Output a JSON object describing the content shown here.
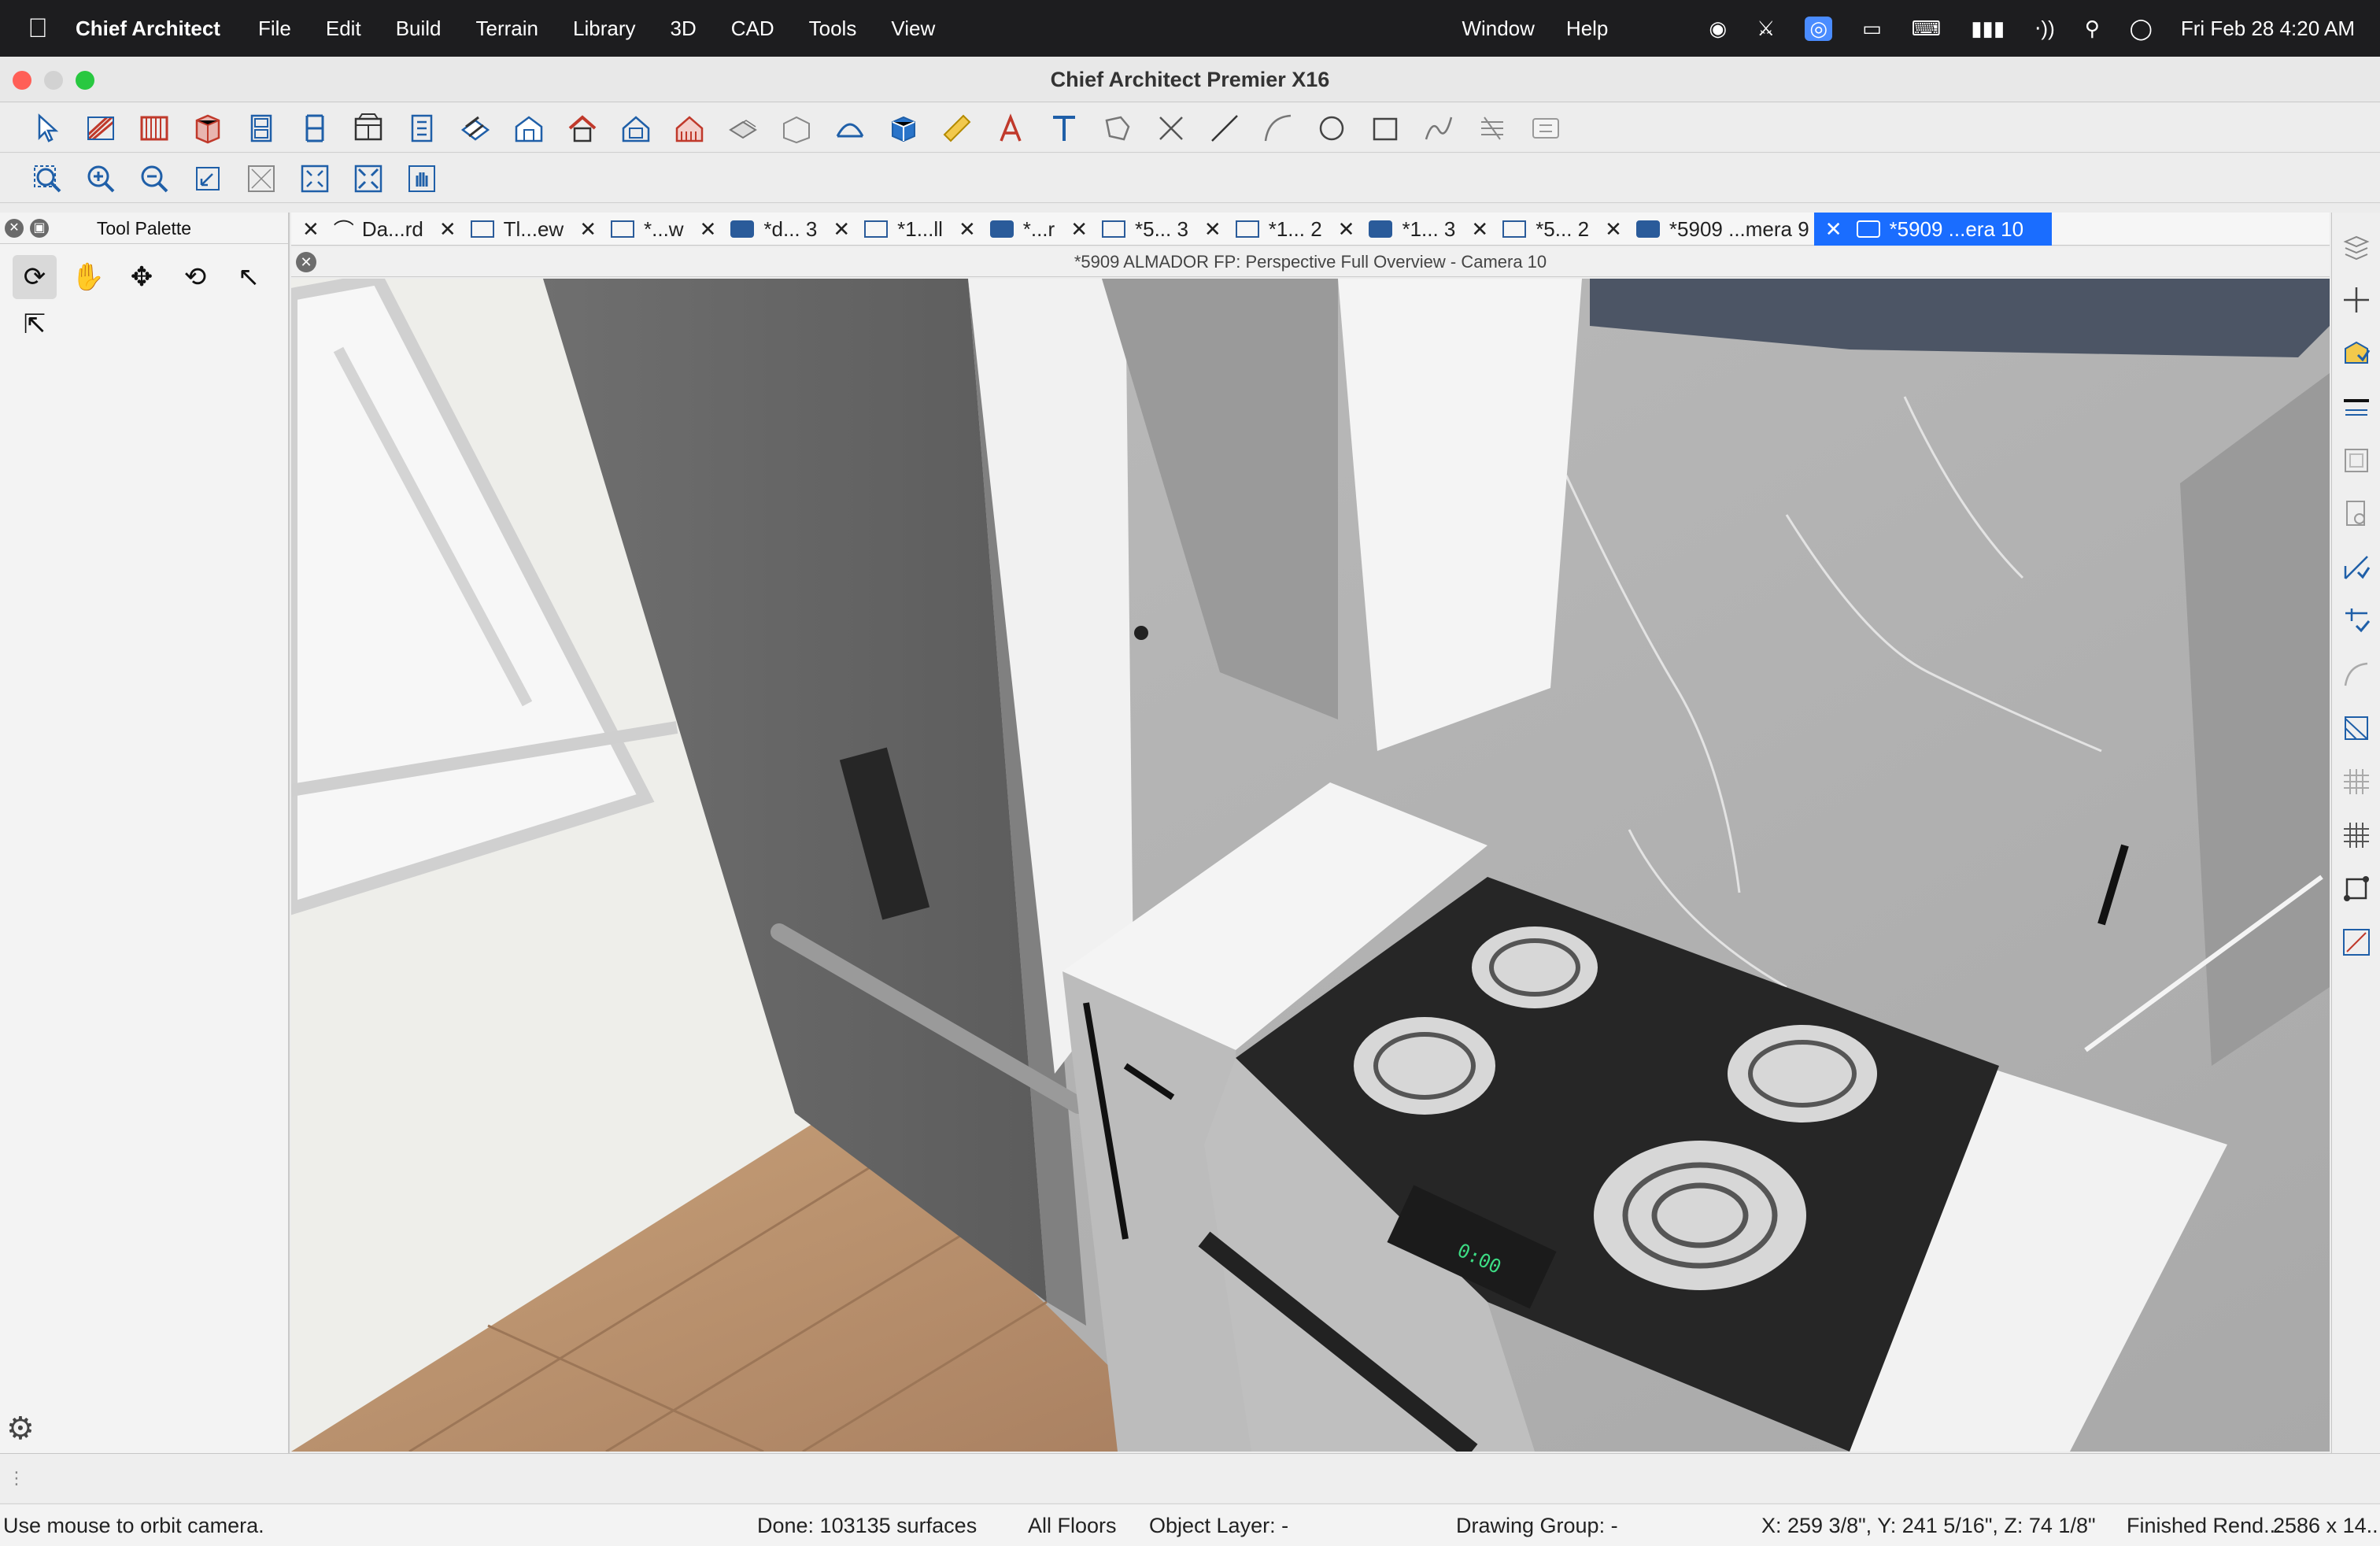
{
  "menubar": {
    "app_name": "Chief Architect",
    "menus": [
      "File",
      "Edit",
      "Build",
      "Terrain",
      "Library",
      "3D",
      "CAD",
      "Tools",
      "View"
    ],
    "menus_right": [
      "Window",
      "Help"
    ],
    "clock": "Fri Feb 28  4:20 AM"
  },
  "window": {
    "title": "Chief Architect Premier X16"
  },
  "palette": {
    "title": "Tool Palette"
  },
  "tabs": [
    {
      "label": "Da...rd"
    },
    {
      "label": "Tl...ew"
    },
    {
      "label": "*...w"
    },
    {
      "label": "*d... 3"
    },
    {
      "label": "*1...ll"
    },
    {
      "label": "*...r"
    },
    {
      "label": "*5... 3"
    },
    {
      "label": "*1... 2"
    },
    {
      "label": "*1... 3"
    },
    {
      "label": "*5... 2"
    },
    {
      "label": "*5909 ...mera 9"
    },
    {
      "label": "*5909 ...era 10"
    }
  ],
  "view": {
    "title": "*5909 ALMADOR FP: Perspective Full Overview - Camera 10"
  },
  "status": {
    "hint": "Use mouse to orbit camera.",
    "done": "Done:  103135 surfaces",
    "floors": "All Floors",
    "layer": "Object Layer: -",
    "group": "Drawing Group: -",
    "coords": "X: 259 3/8\", Y: 241 5/16\", Z: 74 1/8\"",
    "render": "Finished Rend...",
    "size": "2586 x 14..."
  },
  "stove_display": "0:00",
  "colors": {
    "accent": "#1a6dff",
    "menubar": "#1d1d1f"
  }
}
